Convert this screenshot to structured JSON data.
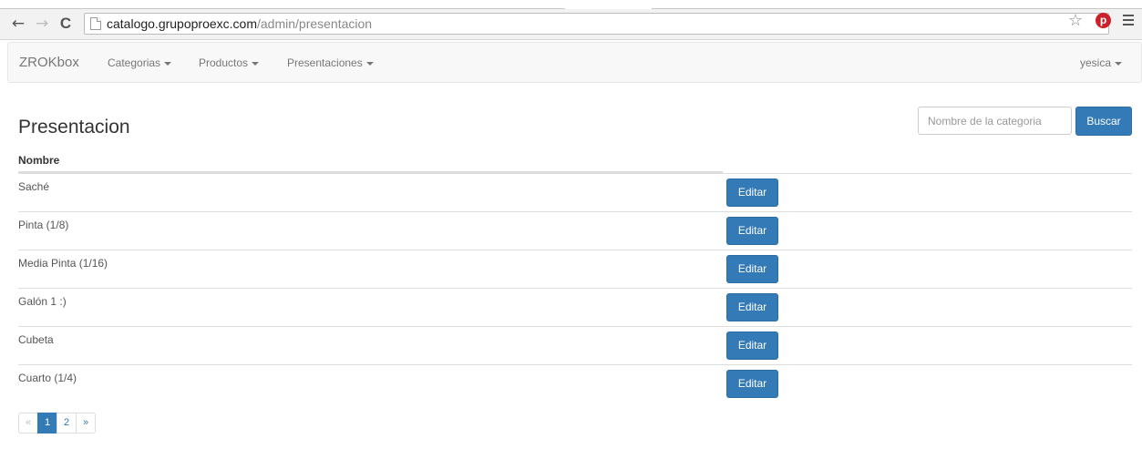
{
  "browser": {
    "url_domain": "catalogo.grupoproexc.com",
    "url_path": "/admin/presentacion",
    "back_glyph": "←",
    "forward_glyph": "→",
    "reload_glyph": "C",
    "star_glyph": "☆",
    "pin_glyph": "p",
    "icons": [
      "back-arrow-icon",
      "forward-arrow-icon",
      "reload-icon",
      "page-icon",
      "star-icon",
      "pinterest-icon",
      "menu-icon"
    ]
  },
  "navbar": {
    "brand": "ZROKbox",
    "items": [
      {
        "label": "Categorias"
      },
      {
        "label": "Productos"
      },
      {
        "label": "Presentaciones"
      }
    ],
    "user": "yesica"
  },
  "page": {
    "title": "Presentacion",
    "search_placeholder": "Nombre de la categoria",
    "search_button": "Buscar"
  },
  "table": {
    "header": "Nombre",
    "edit_label": "Editar",
    "rows": [
      {
        "name": "Saché"
      },
      {
        "name": "Pinta (1/8)"
      },
      {
        "name": "Media Pinta (1/16)"
      },
      {
        "name": "Galón 1 :)"
      },
      {
        "name": "Cubeta"
      },
      {
        "name": "Cuarto (1/4)"
      }
    ]
  },
  "pagination": {
    "prev": "«",
    "pages": [
      "1",
      "2"
    ],
    "next": "»",
    "active_page": "1"
  },
  "colors": {
    "primary": "#337ab7",
    "navbar_bg": "#f8f8f8",
    "pinterest": "#cb2027"
  }
}
